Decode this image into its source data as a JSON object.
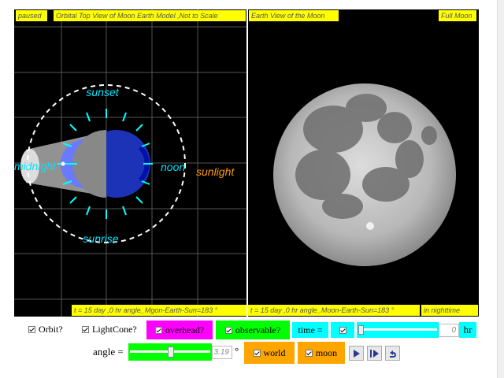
{
  "left_panel": {
    "status": "paused",
    "title": "Orbital Top View of Moon Earth Model ,Not to Scale",
    "footer": "t = 15 day ,0 hr angle_Mgon-Earth-Sun=183 °",
    "labels": {
      "sunset": "sunset",
      "sunrise": "sunrise",
      "midnight": "midnight",
      "noon": "noon",
      "sunlight": "sunlight"
    }
  },
  "right_panel": {
    "title": "Earth View of the Moon",
    "phase": "Full Moon",
    "footer": "t = 15 day ,0 hr angle_Moon-Earth-Sun=183 °",
    "footer2": "in nighttime"
  },
  "controls": {
    "orbit": {
      "label": "Orbit?",
      "checked": true
    },
    "lightcone": {
      "label": "LightCone?",
      "checked": true
    },
    "overhead": {
      "label": "overhead?",
      "checked": true,
      "color": "#ff00ff"
    },
    "observable": {
      "label": "observable?",
      "checked": true,
      "color": "#00ff00"
    },
    "time_label": "time =",
    "time_checked": true,
    "time_value": "0",
    "time_unit": "hr",
    "angle_label": "angle =",
    "angle_value": "3.19",
    "angle_unit": "°",
    "world": {
      "label": "world",
      "checked": true
    },
    "moon": {
      "label": "moon",
      "checked": true
    }
  },
  "colors": {
    "cyan": "#00ffff",
    "label_cyan": "#00e5ff",
    "sunlight": "#ff9900",
    "yellow": "#ffff00",
    "orange_box": "#ffa500"
  }
}
